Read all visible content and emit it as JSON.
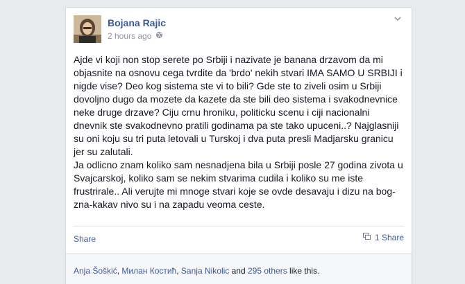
{
  "post": {
    "author": "Bojana Rajic",
    "timestamp": "2 hours ago",
    "privacy_icon": "globe-icon",
    "menu_icon": "chevron-down-icon",
    "paragraph1": "Ajde vi koji non stop serete po Srbiji i nazivate je banana drzavom da mi objasnite na osnovu cega tvrdite da 'brdo' nekih stvari IMA SAMO U SRBIJI i nigde vise? Deo kog sistema ste vi to bili? Gde ste to ziveli osim u Srbiji dovoljno dugo da mozete da kazete da ste bili deo sistema i svakodnevnice neke druge drzave? Ciju crnu hroniku, politicku scenu i ciji nacionalni dnevnik ste svakodnevno pratili godinama pa ste tako upuceni..? Najglasniji su oni koju su tri puta letovali u Turskoj i dva puta presli Madjarsku granicu jer su zalutali.",
    "paragraph2": "Ja odlicno znam koliko sam nesnadjena bila u Srbiji posle 27 godina zivota u Svajcarskoj, koliko sam se nekim stvarima cudila i koliko su me iste frustrirale.. Ali verujte mi mnoge stvari koje se ovde desavaju i dizu na bog-zna-kakav nivo su i na zapadu veoma ceste."
  },
  "actions": {
    "share_label": "Share",
    "share_count_label": "1 Share",
    "share_count_icon": "share-icon"
  },
  "likes": {
    "names": [
      "Anja Šoškić",
      "Милан Костић",
      "Sanja Nikolic"
    ],
    "separator": ", ",
    "conjunction": " and ",
    "others_label": "295 others",
    "suffix": " like this."
  },
  "colors": {
    "link": "#3b5998",
    "meta": "#9197a3",
    "text": "#141823",
    "background": "#e9eaed"
  }
}
